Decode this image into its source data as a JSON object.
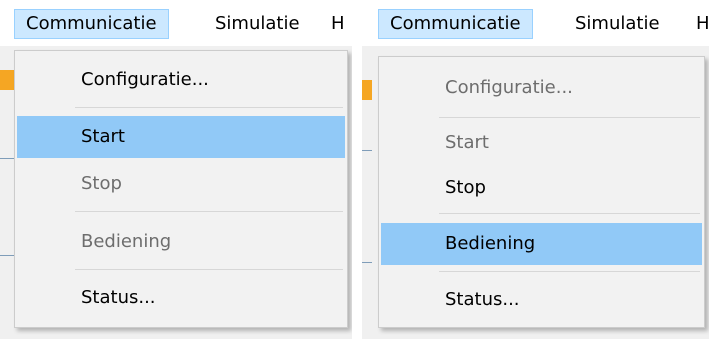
{
  "panels": [
    {
      "menubar": [
        {
          "label": "Communicatie",
          "active": true
        },
        {
          "label": "Simulatie",
          "active": false
        },
        {
          "label": "H",
          "active": false
        }
      ],
      "menu": [
        {
          "label": "Configuratie...",
          "state": "enabled"
        },
        {
          "label": "Start",
          "state": "highlighted"
        },
        {
          "label": "Stop",
          "state": "disabled"
        },
        {
          "label": "Bediening",
          "state": "disabled"
        },
        {
          "label": "Status...",
          "state": "enabled"
        }
      ]
    },
    {
      "menubar": [
        {
          "label": "Communicatie",
          "active": true
        },
        {
          "label": "Simulatie",
          "active": false
        },
        {
          "label": "H",
          "active": false
        }
      ],
      "menu": [
        {
          "label": "Configuratie...",
          "state": "disabled"
        },
        {
          "label": "Start",
          "state": "disabled"
        },
        {
          "label": "Stop",
          "state": "enabled"
        },
        {
          "label": "Bediening",
          "state": "highlighted"
        },
        {
          "label": "Status...",
          "state": "enabled"
        }
      ]
    }
  ],
  "colors": {
    "highlight": "#91c9f7",
    "menubar_active": "#cce8ff",
    "disabled_text": "#6d6d6d"
  }
}
